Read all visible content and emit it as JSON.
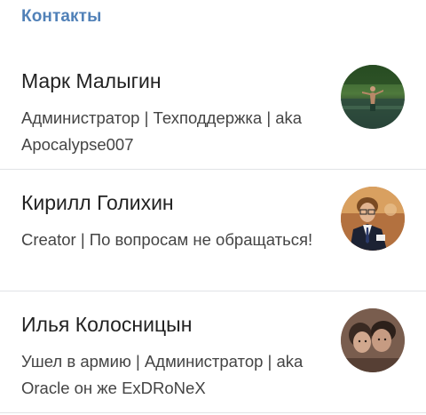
{
  "section": {
    "title": "Контакты"
  },
  "contacts": [
    {
      "name": "Марк Малыгин",
      "description": "Администратор | Техподдержка | aka Apocalypse007",
      "avatar_icon": "person-in-water-photo-avatar"
    },
    {
      "name": "Кирилл Голихин",
      "description": "Creator | По вопросам не обращаться!",
      "avatar_icon": "person-in-suit-photo-avatar"
    },
    {
      "name": "Илья Колосницын",
      "description": "Ушел в армию | Администратор | aka Oracle он же ExDRoNeX",
      "avatar_icon": "two-people-photo-avatar"
    }
  ],
  "colors": {
    "section_title": "#5181b8",
    "name_text": "#222222",
    "description_text": "#444444",
    "divider": "#e1e3e6"
  }
}
